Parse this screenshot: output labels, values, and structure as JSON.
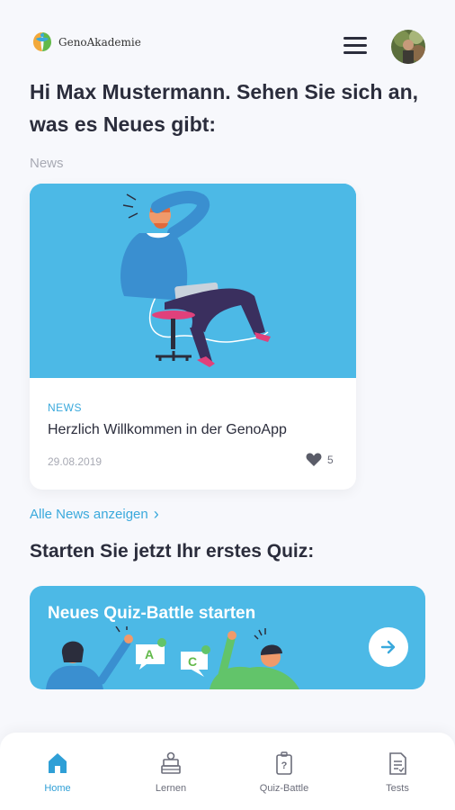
{
  "header": {
    "logo_text": "GenoAkademie",
    "logo_icon": "geno-leaf-logo-icon",
    "menu_icon": "hamburger-menu-icon",
    "avatar_icon": "user-avatar"
  },
  "greeting": "Hi Max Mustermann. Sehen Sie sich an, was es Neues gibt:",
  "news": {
    "section_label": "News",
    "card": {
      "tag": "NEWS",
      "title": "Herzlich Willkommen in der GenoApp",
      "date": "29.08.2019",
      "likes": "5"
    },
    "all_link": "Alle News anzeigen"
  },
  "quiz": {
    "heading": "Starten Sie jetzt Ihr erstes Quiz:",
    "card_title": "Neues Quiz-Battle starten",
    "bubble_a": "A",
    "bubble_c": "C"
  },
  "nav": {
    "items": [
      {
        "label": "Home",
        "icon": "home-icon",
        "active": true
      },
      {
        "label": "Lernen",
        "icon": "books-icon",
        "active": false
      },
      {
        "label": "Quiz-Battle",
        "icon": "quiz-battle-icon",
        "active": false
      },
      {
        "label": "Tests",
        "icon": "tests-document-icon",
        "active": false
      }
    ]
  },
  "colors": {
    "accent": "#3aa9dc",
    "card_blue": "#4cb9e6",
    "text_dark": "#2b2d3c",
    "muted": "#a8aab4"
  }
}
